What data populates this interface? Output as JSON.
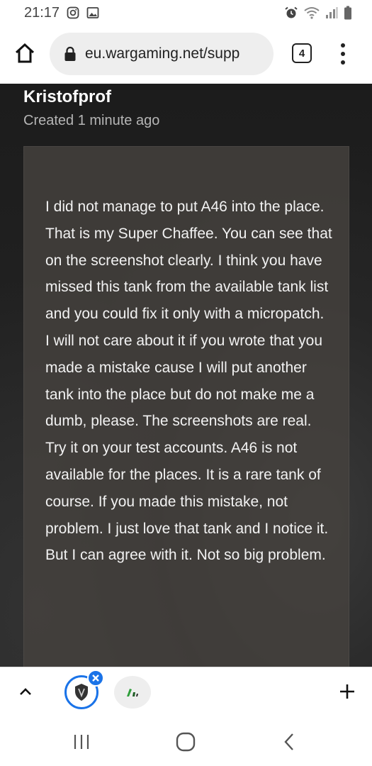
{
  "status_bar": {
    "time": "21:17",
    "icons": [
      "instagram-icon",
      "gallery-icon",
      "alarm-icon",
      "wifi-icon",
      "signal-icon",
      "battery-icon"
    ]
  },
  "browser": {
    "url": "eu.wargaming.net/supp",
    "tab_count": "4",
    "icons": [
      "home-icon",
      "lock-icon",
      "tab-switcher-icon",
      "overflow-menu-icon"
    ]
  },
  "post": {
    "author": "Kristofprof",
    "created": "Created 1 minute ago",
    "body": "I did not manage to put A46 into the place. That is my Super Chaffee. You can see that on the screenshot clearly. I think you have missed this tank from the available tank list and you could fix it only with a micropatch.\nI will not care about it if you wrote that you made a mistake cause I will put another tank into the place but do not make me a dumb, please. The screenshots are real. Try it on your test accounts. A46 is not available for the places. It is a rare tank of course. If you made this mistake, not problem. I just love that tank and I notice it. But I can agree with it. Not so big problem."
  },
  "bottom_bar": {
    "icons": [
      "chevron-up-icon",
      "wot-favicon",
      "close-icon",
      "tab-favicon",
      "plus-icon"
    ]
  },
  "nav_bar": {
    "icons": [
      "recents-icon",
      "home-circle-icon",
      "back-icon"
    ]
  },
  "colors": {
    "accent": "#1a73e8",
    "content_bg": "#222222",
    "message_bg": "#46423e",
    "text": "#f2f2f2"
  }
}
